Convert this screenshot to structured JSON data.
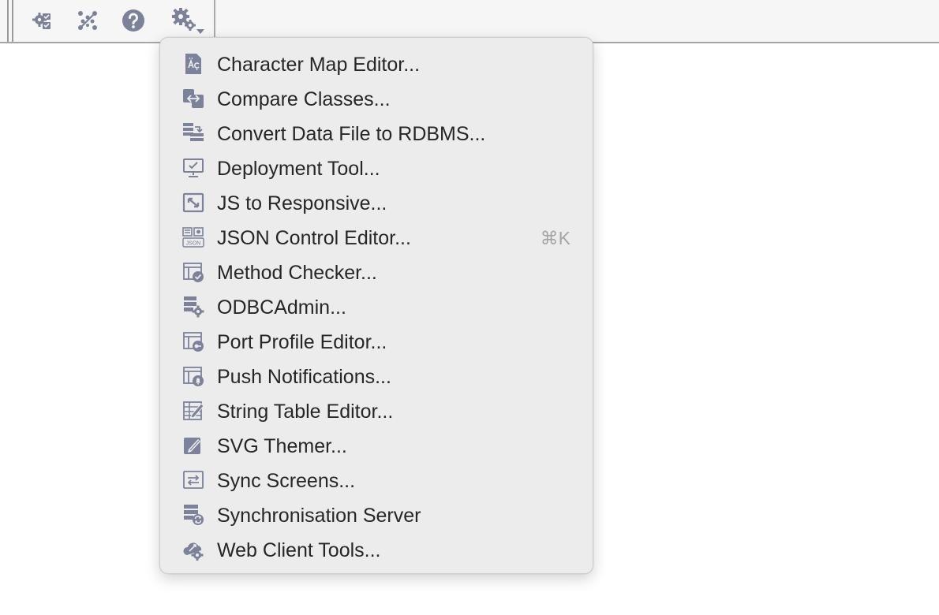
{
  "colors": {
    "icon": "#7b8299",
    "menu_background": "#ececec",
    "menu_text": "#262626",
    "shortcut_text": "#a5a5a5"
  },
  "toolbar": {
    "buttons": [
      {
        "icon": "settings-check-icon"
      },
      {
        "icon": "scatter-nodes-icon"
      },
      {
        "icon": "help-icon"
      },
      {
        "icon": "gears-dropdown-icon"
      }
    ]
  },
  "menu": {
    "items": [
      {
        "label": "Character Map Editor...",
        "icon": "character-map-icon",
        "shortcut": ""
      },
      {
        "label": "Compare Classes...",
        "icon": "compare-classes-icon",
        "shortcut": ""
      },
      {
        "label": "Convert Data File to RDBMS...",
        "icon": "convert-data-icon",
        "shortcut": ""
      },
      {
        "label": "Deployment Tool...",
        "icon": "deployment-monitor-icon",
        "shortcut": ""
      },
      {
        "label": "JS to Responsive...",
        "icon": "responsive-resize-icon",
        "shortcut": ""
      },
      {
        "label": "JSON Control Editor...",
        "icon": "json-control-icon",
        "shortcut": "⌘K"
      },
      {
        "label": "Method Checker...",
        "icon": "method-checker-icon",
        "shortcut": ""
      },
      {
        "label": "ODBCAdmin...",
        "icon": "odbc-admin-icon",
        "shortcut": ""
      },
      {
        "label": "Port Profile Editor...",
        "icon": "port-profile-icon",
        "shortcut": ""
      },
      {
        "label": "Push Notifications...",
        "icon": "push-notification-icon",
        "shortcut": ""
      },
      {
        "label": "String Table Editor...",
        "icon": "string-table-icon",
        "shortcut": ""
      },
      {
        "label": "SVG Themer...",
        "icon": "svg-themer-icon",
        "shortcut": ""
      },
      {
        "label": "Sync Screens...",
        "icon": "sync-screens-icon",
        "shortcut": ""
      },
      {
        "label": "Synchronisation Server",
        "icon": "sync-server-icon",
        "shortcut": ""
      },
      {
        "label": "Web Client Tools...",
        "icon": "web-client-tools-icon",
        "shortcut": ""
      }
    ]
  }
}
